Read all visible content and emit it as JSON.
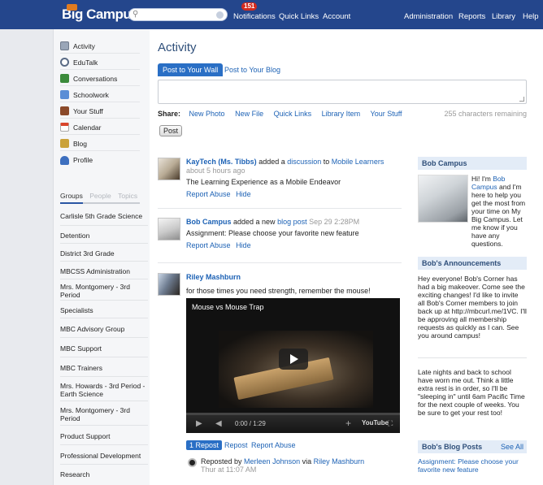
{
  "app": {
    "logo_text": "Big Campus",
    "brand_color": "#24468c",
    "accent_color": "#2a6fc5"
  },
  "topnav": {
    "notifications_count": "151",
    "notifications": "Notifications",
    "quick_links": "Quick Links",
    "account": "Account",
    "administration": "Administration",
    "reports": "Reports",
    "library": "Library",
    "help": "Help"
  },
  "sidebar": {
    "items": [
      {
        "label": "Activity",
        "icon": "activity-icon",
        "color": "#9aa6b8"
      },
      {
        "label": "EduTalk",
        "icon": "edutalk-icon",
        "color": "#5a6b85"
      },
      {
        "label": "Conversations",
        "icon": "conversations-icon",
        "color": "#3c8b3c"
      },
      {
        "label": "Schoolwork",
        "icon": "schoolwork-icon",
        "color": "#5b8ed6"
      },
      {
        "label": "Your Stuff",
        "icon": "your-stuff-icon",
        "color": "#8b4a2a"
      },
      {
        "label": "Calendar",
        "icon": "calendar-icon",
        "color": "#d9452b"
      },
      {
        "label": "Blog",
        "icon": "blog-icon",
        "color": "#caa23a"
      },
      {
        "label": "Profile",
        "icon": "profile-icon",
        "color": "#3d6fbf"
      }
    ],
    "tabs": {
      "groups": "Groups",
      "people": "People",
      "topics": "Topics"
    },
    "groups": [
      "Carlisle 5th Grade Science",
      "Detention",
      "District 3rd Grade",
      "MBCSS Administration",
      "Mrs. Montgomery - 3rd Period",
      "Specialists",
      "MBC Advisory Group",
      "MBC Support",
      "MBC Trainers",
      "Mrs. Howards - 3rd Period - Earth Science",
      "Mrs. Montgomery - 3rd Period",
      "Product Support",
      "Professional Development",
      "Research"
    ]
  },
  "main": {
    "title": "Activity",
    "post_to_wall": "Post to Your Wall",
    "post_to_blog": "Post to Your Blog",
    "share_label": "Share:",
    "share_links": [
      "New Photo",
      "New File",
      "Quick Links",
      "Library Item",
      "Your Stuff"
    ],
    "chars_remaining": "255 characters remaining",
    "post_button": "Post",
    "feed": [
      {
        "author": "KayTech (Ms. Tibbs)",
        "action": " added a ",
        "object": "discussion",
        "connector": " to ",
        "target": "Mobile Learners",
        "time": "about 5 hours ago",
        "body": "The Learning Experience as a Mobile Endeavor",
        "actions": [
          "Report Abuse",
          "Hide"
        ]
      },
      {
        "author": "Bob Campus",
        "action": " added a new ",
        "object": "blog post",
        "time": " Sep 29 2:28PM",
        "body": "Assignment: Please choose your favorite new feature",
        "actions": [
          "Report Abuse",
          "Hide"
        ]
      },
      {
        "author": "Riley Mashburn",
        "body": "for those times you need strength, remember the mouse!",
        "video_title": "Mouse vs Mouse Trap",
        "video_time": "0:00 / 1:29",
        "video_brand": "YouTube",
        "repost_count": "1 Repost",
        "actions": [
          "Repost",
          "Report Abuse"
        ],
        "repost_prefix": "Reposted by ",
        "repost_by": "Merleen Johnson",
        "repost_via": " via ",
        "repost_via_user": "Riley Mashburn",
        "repost_time": "Thur at 11:07 AM"
      }
    ]
  },
  "right": {
    "bob_title": "Bob Campus",
    "bob_intro_1": "Hi! I'm ",
    "bob_intro_link": "Bob Campus",
    "bob_intro_2": " and I'm here to help you get the most from your time on My Big Campus. Let me know if you have any questions.",
    "announcements_title": "Bob's Announcements",
    "announcement_1": "Hey everyone! Bob's Corner has had a big makeover. Come see the exciting changes! I'd like to invite all Bob's Corner members to join back up at http://mbcurl.me/1VC. I'll be approving all membership requests as quickly as I can. See you around campus!",
    "announcement_2": "Late nights and back to school have worn me out. Think a little extra rest is in order, so I'll be \"sleeping in\" until 6am Pacific Time for the next couple of weeks. You be sure to get your rest too!",
    "blog_title": "Bob's Blog Posts",
    "see_all": "See All",
    "blog_post": "Assignment: Please choose your favorite new feature"
  }
}
